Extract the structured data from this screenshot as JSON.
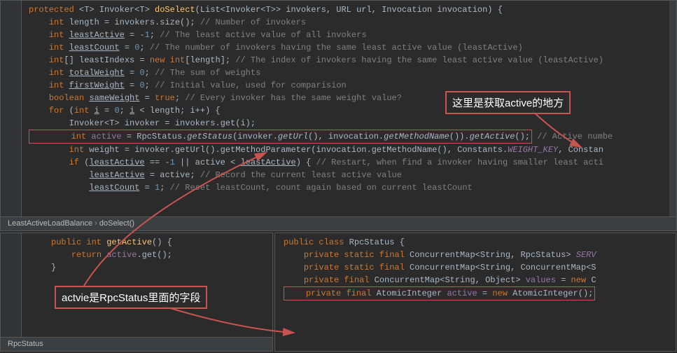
{
  "main": {
    "lines": [
      [
        [
          "kw",
          "protected"
        ],
        [
          "",
          " <T> Invoker<T> "
        ],
        [
          "method",
          "doSelect"
        ],
        [
          "",
          "(List<Invoker<T>> invokers, URL url, Invocation invocation) {"
        ]
      ],
      [
        [
          "",
          "    "
        ],
        [
          "kw",
          "int"
        ],
        [
          "",
          " length = invokers.size(); "
        ],
        [
          "comment",
          "// Number of invokers"
        ]
      ],
      [
        [
          "",
          "    "
        ],
        [
          "kw",
          "int"
        ],
        [
          "",
          " "
        ],
        [
          "und",
          "leastActive"
        ],
        [
          "",
          " = -"
        ],
        [
          "num",
          "1"
        ],
        [
          "",
          "; "
        ],
        [
          "comment",
          "// The least active value of all invokers"
        ]
      ],
      [
        [
          "",
          "    "
        ],
        [
          "kw",
          "int"
        ],
        [
          "",
          " "
        ],
        [
          "und",
          "leastCount"
        ],
        [
          "",
          " = "
        ],
        [
          "num",
          "0"
        ],
        [
          "",
          "; "
        ],
        [
          "comment",
          "// The number of invokers having the same least active value (leastActive)"
        ]
      ],
      [
        [
          "",
          "    "
        ],
        [
          "kw",
          "int"
        ],
        [
          "",
          "[] leastIndexs = "
        ],
        [
          "kw",
          "new int"
        ],
        [
          "",
          "[length]; "
        ],
        [
          "comment",
          "// The index of invokers having the same least active value (leastActive)"
        ]
      ],
      [
        [
          "",
          "    "
        ],
        [
          "kw",
          "int"
        ],
        [
          "",
          " "
        ],
        [
          "und",
          "totalWeight"
        ],
        [
          "",
          " = "
        ],
        [
          "num",
          "0"
        ],
        [
          "",
          "; "
        ],
        [
          "comment",
          "// The sum of weights"
        ]
      ],
      [
        [
          "",
          "    "
        ],
        [
          "kw",
          "int"
        ],
        [
          "",
          " "
        ],
        [
          "und",
          "firstWeight"
        ],
        [
          "",
          " = "
        ],
        [
          "num",
          "0"
        ],
        [
          "",
          "; "
        ],
        [
          "comment",
          "// Initial value, used for comparision"
        ]
      ],
      [
        [
          "",
          "    "
        ],
        [
          "kw",
          "boolean"
        ],
        [
          "",
          " "
        ],
        [
          "und",
          "sameWeight"
        ],
        [
          "",
          " = "
        ],
        [
          "kw",
          "true"
        ],
        [
          "",
          "; "
        ],
        [
          "comment",
          "// Every invoker has the same weight value?"
        ]
      ],
      [
        [
          "",
          "    "
        ],
        [
          "kw",
          "for"
        ],
        [
          "",
          " ("
        ],
        [
          "kw",
          "int"
        ],
        [
          "",
          " "
        ],
        [
          "und",
          "i"
        ],
        [
          "",
          " = "
        ],
        [
          "num",
          "0"
        ],
        [
          "",
          "; "
        ],
        [
          "und",
          "i"
        ],
        [
          "",
          " < length; i++) "
        ],
        [
          "",
          "{"
        ]
      ],
      [
        [
          "",
          "        Invoker<T> invoker = invokers.get(i);"
        ]
      ],
      [
        [
          "hl-outer",
          "        int active = RpcStatus.getStatus(invoker.getUrl(), invocation.getMethodName()).getActive();"
        ],
        [
          "comment",
          " // Active numbe"
        ]
      ],
      [
        [
          "",
          "        "
        ],
        [
          "kw",
          "int"
        ],
        [
          "",
          " weight = invoker.getUrl().getMethodParameter(invocation.getMethodName(), Constants."
        ],
        [
          "field ital",
          "WEIGHT_KEY"
        ],
        [
          "",
          ", Constan"
        ]
      ],
      [
        [
          "",
          "        "
        ],
        [
          "kw",
          "if"
        ],
        [
          "",
          " ("
        ],
        [
          "und",
          "leastActive"
        ],
        [
          "",
          " == -"
        ],
        [
          "num",
          "1"
        ],
        [
          "",
          " || active < "
        ],
        [
          "und",
          "leastActive"
        ],
        [
          "",
          ") { "
        ],
        [
          "comment",
          "// Restart, when find a invoker having smaller least acti"
        ]
      ],
      [
        [
          "",
          "            "
        ],
        [
          "und",
          "leastActive"
        ],
        [
          "",
          " = active; "
        ],
        [
          "comment",
          "// Record the current least active value"
        ]
      ],
      [
        [
          "",
          "            "
        ],
        [
          "und",
          "leastCount"
        ],
        [
          "",
          " = "
        ],
        [
          "num",
          "1"
        ],
        [
          "",
          "; "
        ],
        [
          "comment",
          "// Reset leastCount, count again based on current leastCount"
        ]
      ]
    ],
    "breadcrumb": [
      "LeastActiveLoadBalance",
      "doSelect()"
    ]
  },
  "bottomLeft": {
    "lines": [
      [
        [
          "kw",
          "public int "
        ],
        [
          "method",
          "getActive"
        ],
        [
          "",
          "() {"
        ]
      ],
      [
        [
          "",
          "    "
        ],
        [
          "kw",
          "return "
        ],
        [
          "field",
          "active"
        ],
        [
          "",
          ".get();"
        ]
      ],
      [
        [
          "",
          "}"
        ]
      ]
    ],
    "breadcrumb": [
      "RpcStatus"
    ]
  },
  "bottomRight": {
    "lines": [
      [
        [
          "kw",
          "public class "
        ],
        [
          "",
          "RpcStatus {"
        ]
      ],
      [
        [
          "",
          ""
        ]
      ],
      [
        [
          "",
          "    "
        ],
        [
          "kw",
          "private static final"
        ],
        [
          "",
          " ConcurrentMap<String, RpcStatus> "
        ],
        [
          "field ital",
          "SERV"
        ]
      ],
      [
        [
          "",
          ""
        ]
      ],
      [
        [
          "",
          "    "
        ],
        [
          "kw",
          "private static final"
        ],
        [
          "",
          " ConcurrentMap<String, ConcurrentMap<S"
        ]
      ],
      [
        [
          "",
          "    "
        ],
        [
          "kw",
          "private final"
        ],
        [
          "",
          " ConcurrentMap<String, Object> "
        ],
        [
          "field",
          "values"
        ],
        [
          "",
          " = "
        ],
        [
          "kw",
          "new"
        ],
        [
          "",
          " C"
        ]
      ],
      [
        [
          "hl-outer",
          "    private final AtomicInteger active = new AtomicInteger();"
        ]
      ]
    ]
  },
  "annotations": {
    "top": "这里是获取active的地方",
    "bottom": "actvie是RpcStatus里面的字段"
  }
}
